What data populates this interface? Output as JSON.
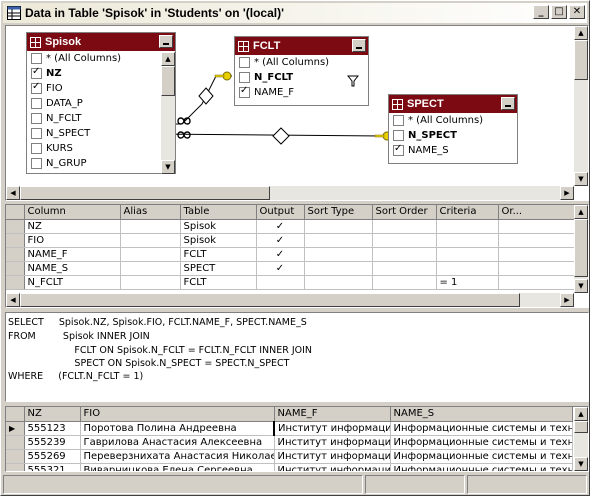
{
  "window": {
    "title": "Data in Table 'Spisok' in 'Students' on '(local)'",
    "buttons": {
      "minimize": "_",
      "maximize": "□",
      "close": "✕"
    }
  },
  "diagram": {
    "tables": [
      {
        "name": "Spisok",
        "fields": [
          {
            "label": "* (All Columns)",
            "checked": false,
            "bold": false
          },
          {
            "label": "NZ",
            "checked": true,
            "bold": true
          },
          {
            "label": "FIO",
            "checked": true,
            "bold": false
          },
          {
            "label": "DATA_P",
            "checked": false,
            "bold": false
          },
          {
            "label": "N_FCLT",
            "checked": false,
            "bold": false
          },
          {
            "label": "N_SPECT",
            "checked": false,
            "bold": false
          },
          {
            "label": "KURS",
            "checked": false,
            "bold": false
          },
          {
            "label": "N_GRUP",
            "checked": false,
            "bold": false
          }
        ]
      },
      {
        "name": "FCLT",
        "fields": [
          {
            "label": "* (All Columns)",
            "checked": false,
            "bold": false
          },
          {
            "label": "N_FCLT",
            "checked": false,
            "bold": true
          },
          {
            "label": "NAME_F",
            "checked": true,
            "bold": false
          }
        ]
      },
      {
        "name": "SPECT",
        "fields": [
          {
            "label": "* (All Columns)",
            "checked": false,
            "bold": false
          },
          {
            "label": "N_SPECT",
            "checked": false,
            "bold": true
          },
          {
            "label": "NAME_S",
            "checked": true,
            "bold": false
          }
        ]
      }
    ]
  },
  "grid": {
    "columns": [
      "Column",
      "Alias",
      "Table",
      "Output",
      "Sort Type",
      "Sort Order",
      "Criteria",
      "Or..."
    ],
    "rows": [
      [
        "NZ",
        "",
        "Spisok",
        "✓",
        "",
        "",
        "",
        ""
      ],
      [
        "FIO",
        "",
        "Spisok",
        "✓",
        "",
        "",
        "",
        ""
      ],
      [
        "NAME_F",
        "",
        "FCLT",
        "✓",
        "",
        "",
        "",
        ""
      ],
      [
        "NAME_S",
        "",
        "SPECT",
        "✓",
        "",
        "",
        "",
        ""
      ],
      [
        "N_FCLT",
        "",
        "FCLT",
        "",
        "",
        "",
        "= 1",
        ""
      ]
    ]
  },
  "sql": {
    "lines": [
      "SELECT     Spisok.NZ, Spisok.FIO, FCLT.NAME_F, SPECT.NAME_S",
      "FROM         Spisok INNER JOIN",
      "                      FCLT ON Spisok.N_FCLT = FCLT.N_FCLT INNER JOIN",
      "                      SPECT ON Spisok.N_SPECT = SPECT.N_SPECT",
      "WHERE     (FCLT.N_FCLT = 1)"
    ]
  },
  "results": {
    "columns": [
      "NZ",
      "FIO",
      "NAME_F",
      "NAME_S"
    ],
    "rows": [
      [
        "555123",
        "Поротова Полина Андреевна",
        "Институт информацис",
        "Информационные системы и техно"
      ],
      [
        "555239",
        "Гаврилова Анастасия Алексеевна",
        "Институт информацис",
        "Информационные системы и техно"
      ],
      [
        "555269",
        "Переверзнихата Анастасия Николаевн",
        "Институт информацис",
        "Информационные системы и техно"
      ],
      [
        "555321",
        "Виварницкова Елена Сергеевна",
        "Институт информацис",
        "Информационные системы и техно"
      ]
    ]
  },
  "colors": {
    "table_header": "#7b0a12",
    "chrome": "#d4d0c8",
    "relationship_key": "#e8d000"
  }
}
